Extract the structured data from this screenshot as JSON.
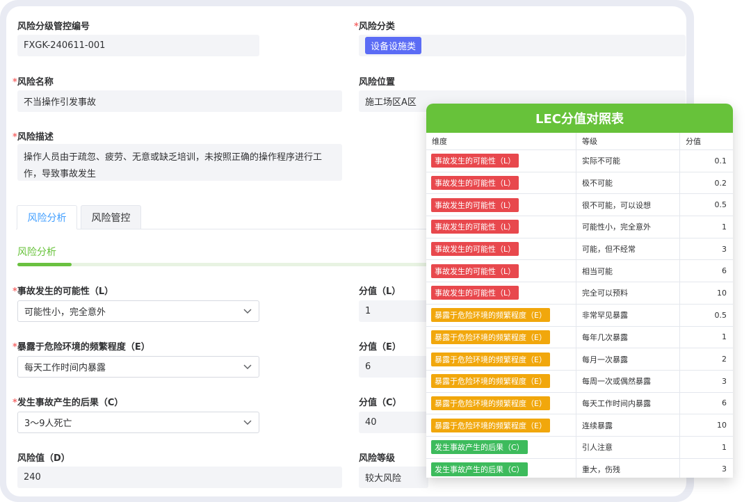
{
  "form": {
    "code_label": "风险分级管控编号",
    "code_value": "FXGK-240611-001",
    "category_label": "风险分类",
    "category_value": "设备设施类",
    "name_label": "风险名称",
    "name_value": "不当操作引发事故",
    "location_label": "风险位置",
    "location_value": "施工场区A区",
    "desc_label": "风险描述",
    "desc_value": "操作人员由于疏忽、疲劳、无意或缺乏培训，未按照正确的操作程序进行工作，导致事故发生",
    "required_mark": "*"
  },
  "tabs": [
    {
      "label": "风险分析",
      "active": true
    },
    {
      "label": "风险管控",
      "active": false
    }
  ],
  "analysis": {
    "section_title": "风险分析",
    "progress_fraction": 0.13,
    "l_label": "事故发生的可能性（L）",
    "l_value": "可能性小，完全意外",
    "l_score_label": "分值（L）",
    "l_score": "1",
    "e_label": "暴露于危险环境的频繁程度（E）",
    "e_value": "每天工作时间内暴露",
    "e_score_label": "分值（E）",
    "e_score": "6",
    "c_label": "发生事故产生的后果（C）",
    "c_value": "3～9人死亡",
    "c_score_label": "分值（C）",
    "c_score": "40",
    "d_label": "风险值（D）",
    "d_value": "240",
    "level_label": "风险等级",
    "level_value": "较大风险"
  },
  "lec_table": {
    "title": "LEC分值对照表",
    "headers": [
      "维度",
      "等级",
      "分值"
    ],
    "colors": {
      "L": "#e8484d",
      "E": "#f1a70c",
      "C": "#3dbb5c"
    },
    "rows": [
      {
        "dim": "事故发生的可能性（L）",
        "type": "L",
        "level": "实际不可能",
        "score": "0.1"
      },
      {
        "dim": "事故发生的可能性（L）",
        "type": "L",
        "level": "极不可能",
        "score": "0.2"
      },
      {
        "dim": "事故发生的可能性（L）",
        "type": "L",
        "level": "很不可能，可以设想",
        "score": "0.5"
      },
      {
        "dim": "事故发生的可能性（L）",
        "type": "L",
        "level": "可能性小，完全意外",
        "score": "1"
      },
      {
        "dim": "事故发生的可能性（L）",
        "type": "L",
        "level": "可能，但不经常",
        "score": "3"
      },
      {
        "dim": "事故发生的可能性（L）",
        "type": "L",
        "level": "相当可能",
        "score": "6"
      },
      {
        "dim": "事故发生的可能性（L）",
        "type": "L",
        "level": "完全可以预料",
        "score": "10"
      },
      {
        "dim": "暴露于危险环境的频繁程度（E）",
        "type": "E",
        "level": "非常罕见暴露",
        "score": "0.5"
      },
      {
        "dim": "暴露于危险环境的频繁程度（E）",
        "type": "E",
        "level": "每年几次暴露",
        "score": "1"
      },
      {
        "dim": "暴露于危险环境的频繁程度（E）",
        "type": "E",
        "level": "每月一次暴露",
        "score": "2"
      },
      {
        "dim": "暴露于危险环境的频繁程度（E）",
        "type": "E",
        "level": "每周一次或偶然暴露",
        "score": "3"
      },
      {
        "dim": "暴露于危险环境的频繁程度（E）",
        "type": "E",
        "level": "每天工作时间内暴露",
        "score": "6"
      },
      {
        "dim": "暴露于危险环境的频繁程度（E）",
        "type": "E",
        "level": "连续暴露",
        "score": "10"
      },
      {
        "dim": "发生事故产生的后果（C）",
        "type": "C",
        "level": "引人注意",
        "score": "1"
      },
      {
        "dim": "发生事故产生的后果（C）",
        "type": "C",
        "level": "重大，伤残",
        "score": "3"
      }
    ]
  }
}
